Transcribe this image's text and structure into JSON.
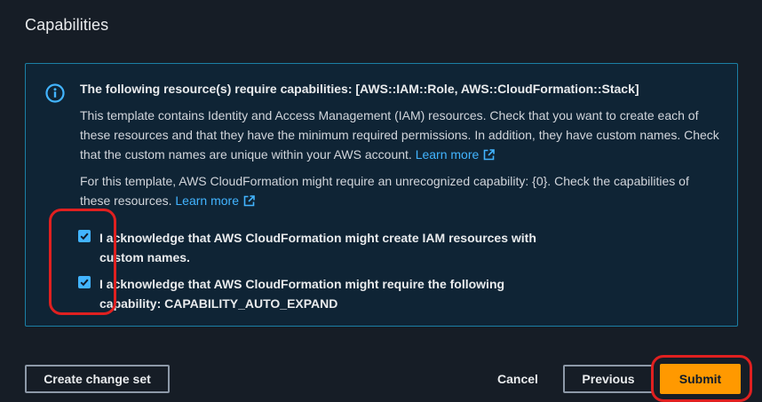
{
  "section": {
    "title": "Capabilities"
  },
  "info": {
    "title": "The following resource(s) require capabilities: [AWS::IAM::Role, AWS::CloudFormation::Stack]",
    "paragraph1": "This template contains Identity and Access Management (IAM) resources. Check that you want to create each of these resources and that they have the minimum required permissions. In addition, they have custom names. Check that the custom names are unique within your AWS account.",
    "link1": "Learn more",
    "paragraph2": "For this template, AWS CloudFormation might require an unrecognized capability: {0}. Check the capabilities of these resources.",
    "link2": "Learn more",
    "icon": "info-icon"
  },
  "acknowledgements": [
    {
      "label": "I acknowledge that AWS CloudFormation might create IAM resources with custom names.",
      "checked": true
    },
    {
      "label": "I acknowledge that AWS CloudFormation might require the following capability: CAPABILITY_AUTO_EXPAND",
      "checked": true
    }
  ],
  "footer": {
    "create_change_set": "Create change set",
    "cancel": "Cancel",
    "previous": "Previous",
    "submit": "Submit"
  },
  "colors": {
    "background": "#161d26",
    "info_border": "#1b7fa5",
    "info_background": "#0f2435",
    "link": "#42b4ff",
    "primary_button": "#ff9900",
    "highlight": "#e02020"
  }
}
